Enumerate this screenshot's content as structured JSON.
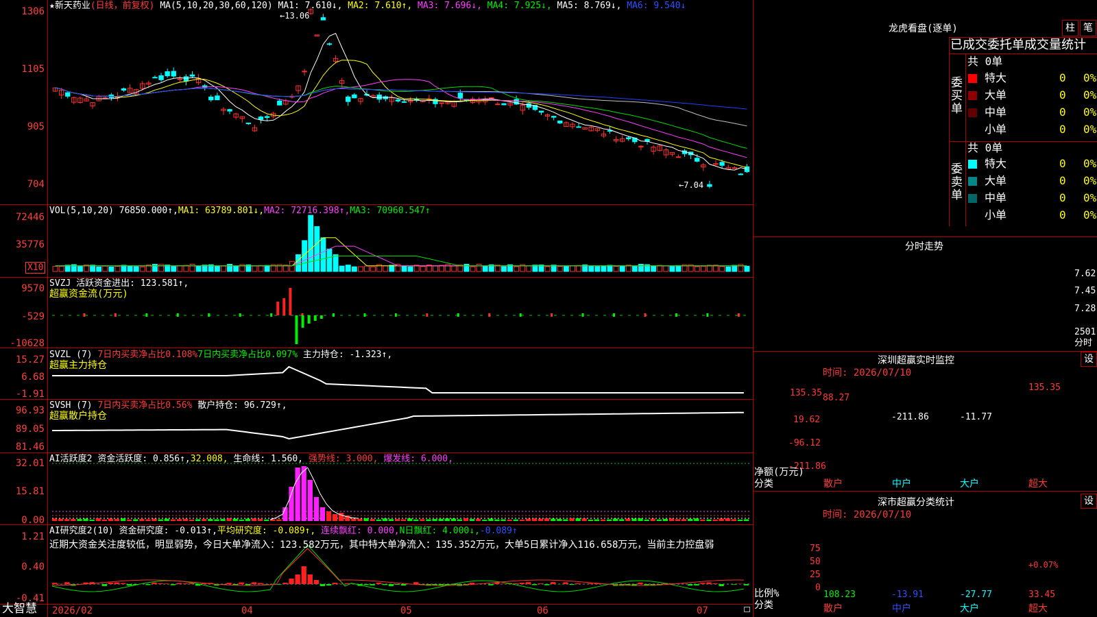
{
  "stock": {
    "star": "★",
    "name": "新天药业",
    "mode": "(日线，前复权)"
  },
  "main_legend": {
    "ma_params": "MA(5,10,20,30,60,120)",
    "ma1": "MA1: 7.610↓,",
    "ma2": "MA2: 7.610↑,",
    "ma3": "MA3: 7.696↓,",
    "ma4": "MA4: 7.925↓,",
    "ma5": "MA5: 8.769↓,",
    "ma6": "MA6: 9.540↓"
  },
  "price_axis": [
    "1306",
    "1105",
    "905",
    "704"
  ],
  "price_marks": {
    "high": "13.06",
    "low": "←7.04",
    "high_arrow": "←"
  },
  "vol_legend": {
    "label": "VOL(5,10,20)",
    "value": "76850.000↑,",
    "ma1": "MA1: 63789.801↓,",
    "ma2": "MA2: 72716.398↑,",
    "ma3": "MA3: 70960.547↑"
  },
  "vol_axis": [
    "72446",
    "35776"
  ],
  "vol_unit": "X10",
  "svzj": {
    "label": "SVZJ",
    "text": "活跃资金进出: 123.581↑,",
    "title": "超赢资金流(万元)",
    "axis": [
      "9570",
      "-529",
      "-10628"
    ]
  },
  "svzl": {
    "label": "SVZL (7)",
    "t1": "7日内买卖净占比0.108%",
    "t2": "7日内买卖净占比0.097%",
    "t3": "主力持仓: -1.323↑,",
    "title": "超赢主力持仓",
    "axis": [
      "15.27",
      "6.68",
      "-1.91"
    ]
  },
  "svsh": {
    "label": "SVSH (7)",
    "t1": "7日内买卖净占比0.56%",
    "t2": "散户持仓: 96.729↑,",
    "title": "超赢散户持仓",
    "axis": [
      "96.93",
      "89.05",
      "81.46"
    ]
  },
  "ai1": {
    "label": "AI活跃度2",
    "t1": "资金活跃度: 0.856↑,",
    "t2": "32.008,",
    "t3": "生命线: 1.560,",
    "t4": "强势线: 3.000,",
    "t5": "爆发线: 6.000,",
    "axis": [
      "32.01",
      "15.81",
      "0.00"
    ]
  },
  "ai2": {
    "label": "AI研究度2(10)",
    "t1": "资金研究度: -0.013↑,",
    "t2": "平均研究度: -0.089↑,",
    "t3": "连续飘红: 0.000,",
    "t4": "N日飘红: 4.000↓,",
    "t5": "-0.089↑",
    "comment": "近期大资金关注度较低，明显弱势，今日大单净流入：123.582万元，其中特大单净流入：135.352万元，大单5日累计净入116.658万元，当前主力控盘弱",
    "axis": [
      "1.21",
      "0.40",
      "-0.41"
    ]
  },
  "date_axis": [
    "2026/02",
    "04",
    "05",
    "06",
    "07"
  ],
  "brand": "大智慧",
  "right_panel": {
    "title": "龙虎看盘(逐单)",
    "btn1": "柱",
    "btn2": "笔",
    "header": "已成交委托单成交量统计",
    "buy": {
      "side": "委买单",
      "total": "共 0单",
      "rows": [
        {
          "name": "特大",
          "vol": "0",
          "pct": "0%",
          "color": "#ff0000"
        },
        {
          "name": "大单",
          "vol": "0",
          "pct": "0%",
          "color": "#900000"
        },
        {
          "name": "中单",
          "vol": "0",
          "pct": "0%",
          "color": "#600000"
        },
        {
          "name": "小单",
          "vol": "0",
          "pct": "0%",
          "color": "#000000"
        }
      ]
    },
    "sell": {
      "side": "委卖单",
      "total": "共 0单",
      "rows": [
        {
          "name": "特大",
          "vol": "0",
          "pct": "0%",
          "color": "#00ffff"
        },
        {
          "name": "大单",
          "vol": "0",
          "pct": "0%",
          "color": "#008888"
        },
        {
          "name": "中单",
          "vol": "0",
          "pct": "0%",
          "color": "#006666"
        },
        {
          "name": "小单",
          "vol": "0",
          "pct": "0%",
          "color": "#000000"
        }
      ]
    },
    "intraday": {
      "title": "分时走势",
      "axis": [
        "7.62",
        "7.45",
        "7.28",
        "2501",
        "分时"
      ]
    },
    "monitor": {
      "title": "深圳超赢实时监控",
      "time": "时间: 2026/07/10",
      "btn": "设",
      "axis": [
        "135.35",
        "19.62",
        "-96.12",
        "-211.86"
      ],
      "ylabel": "净额(万元)",
      "xlabel": "分类",
      "cats": [
        "散户",
        "中户",
        "大户",
        "超大"
      ],
      "labels": [
        "88.27",
        "-211.86",
        "-11.77",
        "135.35"
      ]
    },
    "classify": {
      "title": "深市超赢分类统计",
      "time": "时间: 2026/07/10",
      "btn": "设",
      "axis": [
        "75",
        "50",
        "25",
        "0"
      ],
      "ylabel": "比例%",
      "xlabel": "分类",
      "cats": [
        "散户",
        "中户",
        "大户",
        "超大"
      ],
      "pcts": [
        "108.23",
        "-13.91",
        "-27.77",
        "33.45"
      ],
      "extra": "+0.07%"
    }
  },
  "chart_data": [
    {
      "type": "candlestick",
      "title": "新天药业",
      "ylim": [
        7.04,
        13.06
      ],
      "ma": {
        "MA1": 7.61,
        "MA2": 7.61,
        "MA3": 7.696,
        "MA4": 7.925,
        "MA5": 8.769,
        "MA6": 9.54
      },
      "high": 13.06,
      "low": 7.04,
      "x": [
        "2026/02",
        "04",
        "05",
        "06",
        "07"
      ]
    },
    {
      "type": "bar",
      "title": "VOL",
      "values_latest": 76850.0,
      "ma": {
        "MA1": 63789.801,
        "MA2": 72716.398,
        "MA3": 70960.547
      },
      "yticks": [
        72446,
        35776
      ]
    },
    {
      "type": "bar",
      "title": "超赢资金流(万元)",
      "latest": 123.581,
      "yticks": [
        9570,
        -529,
        -10628
      ]
    },
    {
      "type": "line",
      "title": "超赢主力持仓",
      "latest": -1.323,
      "yticks": [
        15.27,
        6.68,
        -1.91
      ]
    },
    {
      "type": "line",
      "title": "超赢散户持仓",
      "latest": 96.729,
      "yticks": [
        96.93,
        89.05,
        81.46
      ]
    },
    {
      "type": "bar",
      "title": "AI活跃度2",
      "values": {
        "资金活跃度": 0.856,
        "生命线": 1.56,
        "强势线": 3.0,
        "爆发线": 6.0
      },
      "yticks": [
        32.01,
        15.81,
        0.0
      ]
    },
    {
      "type": "bar",
      "title": "AI研究度2(10)",
      "values": {
        "资金研究度": -0.013,
        "平均研究度": -0.089,
        "连续飘红": 0.0,
        "N日飘红": 4.0
      },
      "yticks": [
        1.21,
        0.4,
        -0.41
      ]
    },
    {
      "type": "bar",
      "title": "深圳超赢实时监控",
      "categories": [
        "散户",
        "中户",
        "大户",
        "超大"
      ],
      "values": [
        88.27,
        -211.86,
        -11.77,
        135.35
      ],
      "ylim": [
        -211.86,
        135.35
      ]
    },
    {
      "type": "bar",
      "title": "深市超赢分类统计",
      "categories": [
        "散户",
        "中户",
        "大户",
        "超大"
      ],
      "values": [
        108.23,
        -13.91,
        -27.77,
        33.45
      ],
      "yticks": [
        75,
        50,
        25,
        0
      ]
    }
  ]
}
